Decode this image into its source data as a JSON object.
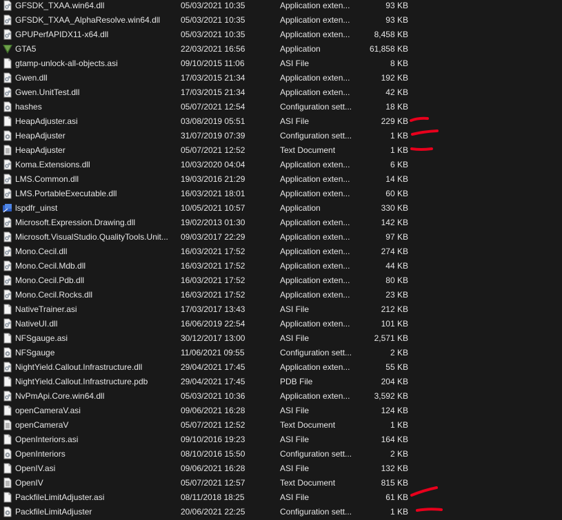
{
  "files": [
    {
      "name": "GFSDK_TXAA.win64.dll",
      "date": "05/03/2021 10:35",
      "type": "Application exten...",
      "size": "93 KB",
      "icon": "dll-file-icon"
    },
    {
      "name": "GFSDK_TXAA_AlphaResolve.win64.dll",
      "date": "05/03/2021 10:35",
      "type": "Application exten...",
      "size": "93 KB",
      "icon": "dll-file-icon"
    },
    {
      "name": "GPUPerfAPIDX11-x64.dll",
      "date": "05/03/2021 10:35",
      "type": "Application exten...",
      "size": "8,458 KB",
      "icon": "dll-file-icon"
    },
    {
      "name": "GTA5",
      "date": "22/03/2021 16:56",
      "type": "Application",
      "size": "61,858 KB",
      "icon": "gta5-app-icon"
    },
    {
      "name": "gtamp-unlock-all-objects.asi",
      "date": "09/10/2015 11:06",
      "type": "ASI File",
      "size": "8 KB",
      "icon": "blank-file-icon"
    },
    {
      "name": "Gwen.dll",
      "date": "17/03/2015 21:34",
      "type": "Application exten...",
      "size": "192 KB",
      "icon": "dll-file-icon"
    },
    {
      "name": "Gwen.UnitTest.dll",
      "date": "17/03/2015 21:34",
      "type": "Application exten...",
      "size": "42 KB",
      "icon": "dll-file-icon"
    },
    {
      "name": "hashes",
      "date": "05/07/2021 12:54",
      "type": "Configuration sett...",
      "size": "18 KB",
      "icon": "config-file-icon"
    },
    {
      "name": "HeapAdjuster.asi",
      "date": "03/08/2019 05:51",
      "type": "ASI File",
      "size": "229 KB",
      "icon": "blank-file-icon"
    },
    {
      "name": "HeapAdjuster",
      "date": "31/07/2019 07:39",
      "type": "Configuration sett...",
      "size": "1 KB",
      "icon": "config-file-icon"
    },
    {
      "name": "HeapAdjuster",
      "date": "05/07/2021 12:52",
      "type": "Text Document",
      "size": "1 KB",
      "icon": "text-file-icon"
    },
    {
      "name": "Koma.Extensions.dll",
      "date": "10/03/2020 04:04",
      "type": "Application exten...",
      "size": "6 KB",
      "icon": "dll-file-icon"
    },
    {
      "name": "LMS.Common.dll",
      "date": "19/03/2016 21:29",
      "type": "Application exten...",
      "size": "14 KB",
      "icon": "dll-file-icon"
    },
    {
      "name": "LMS.PortableExecutable.dll",
      "date": "16/03/2021 18:01",
      "type": "Application exten...",
      "size": "60 KB",
      "icon": "dll-file-icon"
    },
    {
      "name": "lspdfr_uinst",
      "date": "10/05/2021 10:57",
      "type": "Application",
      "size": "330 KB",
      "icon": "installer-app-icon"
    },
    {
      "name": "Microsoft.Expression.Drawing.dll",
      "date": "19/02/2013 01:30",
      "type": "Application exten...",
      "size": "142 KB",
      "icon": "dll-file-icon"
    },
    {
      "name": "Microsoft.VisualStudio.QualityTools.Unit...",
      "date": "09/03/2017 22:29",
      "type": "Application exten...",
      "size": "97 KB",
      "icon": "dll-file-icon"
    },
    {
      "name": "Mono.Cecil.dll",
      "date": "16/03/2021 17:52",
      "type": "Application exten...",
      "size": "274 KB",
      "icon": "dll-file-icon"
    },
    {
      "name": "Mono.Cecil.Mdb.dll",
      "date": "16/03/2021 17:52",
      "type": "Application exten...",
      "size": "44 KB",
      "icon": "dll-file-icon"
    },
    {
      "name": "Mono.Cecil.Pdb.dll",
      "date": "16/03/2021 17:52",
      "type": "Application exten...",
      "size": "80 KB",
      "icon": "dll-file-icon"
    },
    {
      "name": "Mono.Cecil.Rocks.dll",
      "date": "16/03/2021 17:52",
      "type": "Application exten...",
      "size": "23 KB",
      "icon": "dll-file-icon"
    },
    {
      "name": "NativeTrainer.asi",
      "date": "17/03/2017 13:43",
      "type": "ASI File",
      "size": "212 KB",
      "icon": "blank-file-icon"
    },
    {
      "name": "NativeUI.dll",
      "date": "16/06/2019 22:54",
      "type": "Application exten...",
      "size": "101 KB",
      "icon": "dll-file-icon"
    },
    {
      "name": "NFSgauge.asi",
      "date": "30/12/2017 13:00",
      "type": "ASI File",
      "size": "2,571 KB",
      "icon": "blank-file-icon"
    },
    {
      "name": "NFSgauge",
      "date": "11/06/2021 09:55",
      "type": "Configuration sett...",
      "size": "2 KB",
      "icon": "config-file-icon"
    },
    {
      "name": "NightYield.Callout.Infrastructure.dll",
      "date": "29/04/2021 17:45",
      "type": "Application exten...",
      "size": "55 KB",
      "icon": "dll-file-icon"
    },
    {
      "name": "NightYield.Callout.Infrastructure.pdb",
      "date": "29/04/2021 17:45",
      "type": "PDB File",
      "size": "204 KB",
      "icon": "blank-file-icon"
    },
    {
      "name": "NvPmApi.Core.win64.dll",
      "date": "05/03/2021 10:36",
      "type": "Application exten...",
      "size": "3,592 KB",
      "icon": "dll-file-icon"
    },
    {
      "name": "openCameraV.asi",
      "date": "09/06/2021 16:28",
      "type": "ASI File",
      "size": "124 KB",
      "icon": "blank-file-icon"
    },
    {
      "name": "openCameraV",
      "date": "05/07/2021 12:52",
      "type": "Text Document",
      "size": "1 KB",
      "icon": "text-file-icon"
    },
    {
      "name": "OpenInteriors.asi",
      "date": "09/10/2016 19:23",
      "type": "ASI File",
      "size": "164 KB",
      "icon": "blank-file-icon"
    },
    {
      "name": "OpenInteriors",
      "date": "08/10/2016 15:50",
      "type": "Configuration sett...",
      "size": "2 KB",
      "icon": "config-file-icon"
    },
    {
      "name": "OpenIV.asi",
      "date": "09/06/2021 16:28",
      "type": "ASI File",
      "size": "132 KB",
      "icon": "blank-file-icon"
    },
    {
      "name": "OpenIV",
      "date": "05/07/2021 12:57",
      "type": "Text Document",
      "size": "815 KB",
      "icon": "text-file-icon"
    },
    {
      "name": "PackfileLimitAdjuster.asi",
      "date": "08/11/2018 18:25",
      "type": "ASI File",
      "size": "61 KB",
      "icon": "blank-file-icon"
    },
    {
      "name": "PackfileLimitAdjuster",
      "date": "20/06/2021 22:25",
      "type": "Configuration sett...",
      "size": "1 KB",
      "icon": "config-file-icon"
    }
  ],
  "annotation_color": "#e8001c"
}
